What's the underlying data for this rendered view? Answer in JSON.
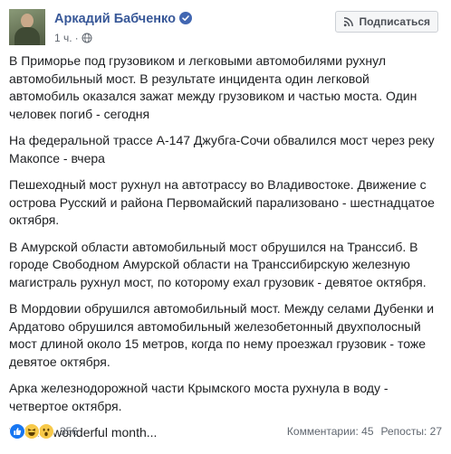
{
  "post": {
    "author": "Аркадий Бабченко",
    "time": "1 ч.",
    "subscribe_label": "Подписаться",
    "paragraphs": [
      "В Приморье под грузовиком и легковыми автомобилями рухнул автомобильный мост. В результате инцидента один легковой автомобиль оказался зажат между грузовиком и частью моста. Один человек погиб - сегодня",
      "На федеральной трассе А-147 Джубга-Сочи обвалился мост через реку Макопсе - вчера",
      "Пешеходный мост рухнул на автотрассу во Владивостоке. Движение с острова Русский и района Первомайский парализовано - шестнадцатое октября.",
      "В Амурской области автомобильный мост обрушился на Транссиб. В городе Свободном Амурской области на Транссибирскую железную магистраль рухнул мост, по которому ехал грузовик - девятое октября.",
      "В Мордовии обрушился автомобильный мост. Между селами Дубенки и Ардатово обрушился автомобильный железобетонный двухполосный мост длиной около 15 метров, когда по нему проезжал грузовик - тоже девятое октября.",
      "Арка железнодорожной части Крымского моста рухнула в воду - четвертое октября.",
      "What a wonderful month..."
    ],
    "reaction_count": "356",
    "comments": "Комментарии: 45",
    "reposts": "Репосты: 27"
  },
  "icons": {
    "avatar": "avatar-photo",
    "verified": "verified-badge-icon",
    "privacy": "globe-icon",
    "subscribe": "rss-icon",
    "reactions": [
      "like-icon",
      "haha-icon",
      "wow-icon"
    ]
  },
  "colors": {
    "author_link": "#385898",
    "verified": "#4267b2",
    "meta_text": "#606770",
    "body_text": "#1c1e21",
    "like": "#1877f2",
    "emoji": "#f7c94a"
  }
}
